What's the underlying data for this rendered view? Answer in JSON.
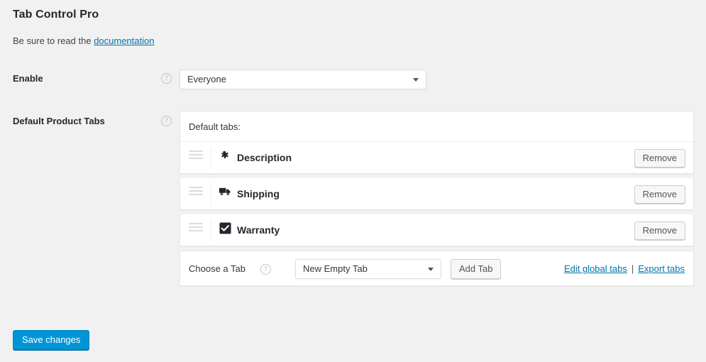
{
  "header": {
    "title": "Tab Control Pro",
    "subtitle_prefix": "Be sure to read the ",
    "subtitle_link": "documentation"
  },
  "fields": {
    "enable": {
      "label": "Enable",
      "help": "?",
      "value": "Everyone"
    },
    "default_product_tabs": {
      "label": "Default Product Tabs",
      "help": "?"
    }
  },
  "panel": {
    "heading": "Default tabs:",
    "rows": [
      {
        "name": "Description",
        "icon": "asterisk-icon",
        "remove_label": "Remove"
      },
      {
        "name": "Shipping",
        "icon": "truck-icon",
        "remove_label": "Remove"
      },
      {
        "name": "Warranty",
        "icon": "checkbox-checked-icon",
        "remove_label": "Remove"
      }
    ],
    "footer": {
      "choose_label": "Choose a Tab",
      "choose_help": "?",
      "select_value": "New Empty Tab",
      "add_button": "Add Tab",
      "edit_global_link": "Edit global tabs",
      "separator": "|",
      "export_link": "Export tabs"
    }
  },
  "actions": {
    "save_label": "Save changes"
  },
  "colors": {
    "background": "#f1f1f1",
    "link": "#0073aa",
    "primary_button": "#0095d7",
    "panel_background": "#ffffff",
    "border": "#e5e5e5",
    "text": "#23282d"
  }
}
